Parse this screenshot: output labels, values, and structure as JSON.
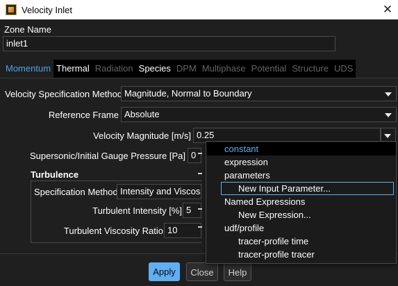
{
  "window": {
    "title": "Velocity Inlet",
    "close_glyph": "✕"
  },
  "zone": {
    "label": "Zone Name",
    "value": "inlet1"
  },
  "tabs": [
    {
      "label": "Momentum",
      "state": "active"
    },
    {
      "label": "Thermal",
      "state": "enabled"
    },
    {
      "label": "Radiation",
      "state": "disabled"
    },
    {
      "label": "Species",
      "state": "enabled"
    },
    {
      "label": "DPM",
      "state": "disabled"
    },
    {
      "label": "Multiphase",
      "state": "disabled"
    },
    {
      "label": "Potential",
      "state": "disabled"
    },
    {
      "label": "Structure",
      "state": "disabled"
    },
    {
      "label": "UDS",
      "state": "disabled"
    }
  ],
  "momentum": {
    "spec_method_label": "Velocity Specification Method",
    "spec_method_value": "Magnitude, Normal to Boundary",
    "ref_frame_label": "Reference Frame",
    "ref_frame_value": "Absolute",
    "velocity_label": "Velocity Magnitude [m/s]",
    "velocity_value": "0.25",
    "pressure_label": "Supersonic/Initial Gauge Pressure [Pa]",
    "pressure_value": "0"
  },
  "turbulence": {
    "title": "Turbulence",
    "spec_method_label": "Specification Method",
    "spec_method_value": "Intensity and Viscosity Ratio",
    "intensity_label": "Turbulent Intensity [%]",
    "intensity_value": "5",
    "viscosity_ratio_label": "Turbulent Viscosity Ratio",
    "viscosity_ratio_value": "10"
  },
  "buttons": {
    "apply": "Apply",
    "close": "Close",
    "help": "Help"
  },
  "dropdown_menu": {
    "items": [
      {
        "label": "constant",
        "level": 0,
        "state": "selected"
      },
      {
        "label": "expression",
        "level": 0,
        "state": "normal"
      },
      {
        "label": "parameters",
        "level": 0,
        "state": "normal"
      },
      {
        "label": "New Input Parameter...",
        "level": 1,
        "state": "hovered"
      },
      {
        "label": "Named Expressions",
        "level": 0,
        "state": "normal"
      },
      {
        "label": "New Expression...",
        "level": 1,
        "state": "normal"
      },
      {
        "label": "udf/profile",
        "level": 0,
        "state": "normal"
      },
      {
        "label": "tracer-profile time",
        "level": 1,
        "state": "normal"
      },
      {
        "label": "tracer-profile tracer",
        "level": 1,
        "state": "normal"
      }
    ]
  },
  "colors": {
    "accent": "#61aef1",
    "tab_active": "#4fa3e8",
    "background": "#1f1f1f"
  }
}
